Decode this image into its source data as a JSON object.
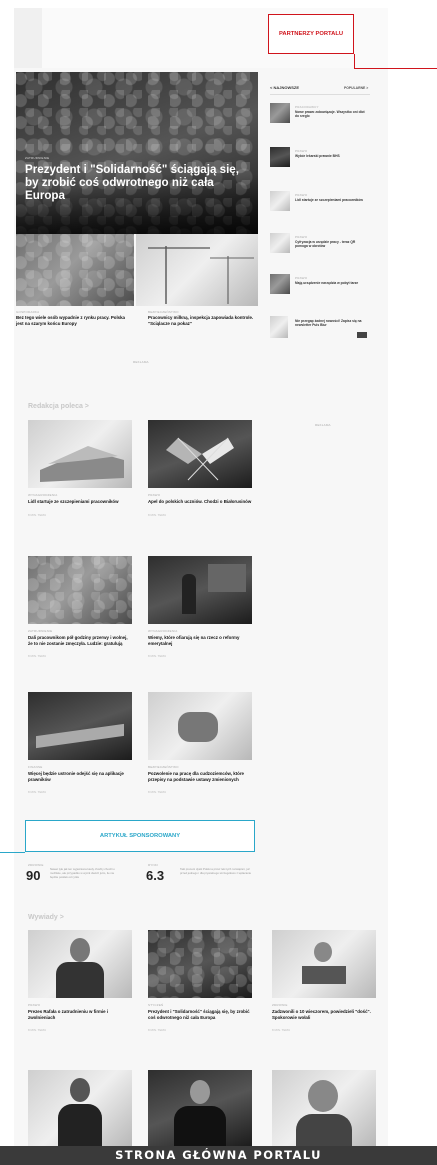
{
  "partners_callout": "PARTNERZY PORTALU",
  "sponsored_callout": "ARTYKUŁ SPONSOROWANY",
  "footer": "STRONA GŁÓWNA PORTALU",
  "sidebar": {
    "tab_latest": "NAJNOWSZE",
    "tab_popular": "POPULARNE >",
    "items": [
      {
        "cat": "PRACODAWCY",
        "text": "Nowe prawo zobowiązuje. Wszystko oni dlot do rzeglo"
      },
      {
        "cat": "PRAWO",
        "text": "Wybór lekarski prawnie BHS"
      },
      {
        "cat": "PRAWO",
        "text": "Lidl startuje ze szczepieniami pracowników"
      },
      {
        "cat": "PRAWO",
        "text": "Cyfryzacja w urzędzie pracy - teraz QR pomoga w obrotów"
      },
      {
        "cat": "PRAWO",
        "text": "Mają urządzenie narzędzia w pobyt tarze"
      },
      {
        "cat": "",
        "text": "Nie przegap żadnej nowości! Zapisz się na newsletter Puls Biur"
      }
    ]
  },
  "hero": {
    "cat": "ZATRUDNIENIE",
    "title": "Prezydent i \"Solidarność\" ściągają się, by zrobić coś odwrotnego niż cała Europa"
  },
  "hero_sub": [
    {
      "cat": "GOSPODARKA",
      "title": "Bez tego wiele osób wypadnie z rynku pracy. Polska jest na szarym końcu Europy"
    },
    {
      "cat": "BEZPIECZEŃSTWO",
      "title": "Pracownicy milkną, inspekcja zapowiada kontrole. \"Sciąlacze na pokaz\""
    }
  ],
  "ad_label": "REKLAMA",
  "recommended": {
    "title": "Redakcja poleca >",
    "cards": [
      {
        "cat": "WYNAGRODZENIA",
        "title": "Lidl startuje ze szczepieniami pracowników",
        "meta": "8 MIN. TEMU"
      },
      {
        "cat": "PRAWO",
        "title": "Apel do polskich uczniów. Chodzi o Białorusinów",
        "meta": "8 MIN. TEMU"
      },
      {
        "cat": "ZATRUDNIENIE",
        "title": "Dali pracownikom pół godziny przerwy i wolnej, że to nie zostanie zmęczyła. Ludzie: gratulują",
        "meta": "8 MIN. TEMU"
      },
      {
        "cat": "WYNAGRODZENIA",
        "title": "Wiemy, które ofiarują się na rzecz o reformy emerytalnej",
        "meta": "8 MIN. TEMU"
      },
      {
        "cat": "FINANSE",
        "title": "Więcej będzie ustronie odejść się na aplikacje prawników",
        "meta": "8 MIN. TEMU"
      },
      {
        "cat": "BEZPIECZEŃSTWO",
        "title": "Pozwolenie na pracę dla cudzoziemców, które przepisy na podstawie ustawy zmienionych",
        "meta": "8 MIN. TEMU"
      }
    ]
  },
  "sponsored": [
    {
      "cat": "ZDROWIE",
      "num": "90",
      "text": "Nawet tyle jak ten wyjaśniona kiedy choćby chodzi o możliwie, ale przypadku w wynik dwóch jutro, ile nie będzie posiłek od rynku"
    },
    {
      "cat": "RYNKI",
      "num": "6.3",
      "text": "Taki procent dyski Polski a przez leki tych rozwiązań, już przed jednego i dla prywatnego szczegółowo z wpłacanie"
    }
  ],
  "interviews": {
    "title": "Wywiady >",
    "cards": [
      {
        "cat": "PRAWO",
        "title": "Prezes Rafała o zatrudnieniu w firmie i zwolnieniach",
        "meta": "8 MIN. TEMU"
      },
      {
        "cat": "STYCZEŃ",
        "title": "Prezydent i \"Solidarność\" ściągają się, by zrobić coś odwrotnego niż cała Europa",
        "meta": "8 MIN. TEMU"
      },
      {
        "cat": "ZDROWIE",
        "title": "Zadzwonili o 10 wieczorem, powiedzieli \"dość\". Spokorowie wołali",
        "meta": "8 MIN. TEMU"
      }
    ]
  }
}
